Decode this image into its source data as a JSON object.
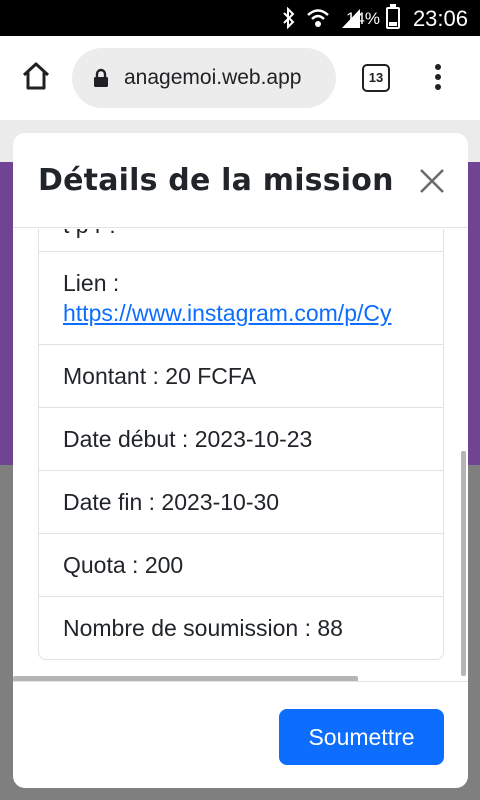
{
  "status_bar": {
    "battery_percent": "14%",
    "time": "23:06",
    "icons": [
      "bluetooth-icon",
      "wifi-icon",
      "signal-icon",
      "battery-icon"
    ]
  },
  "browser": {
    "url": "anagemoi.web.app",
    "tab_count": "13"
  },
  "modal": {
    "title": "Détails de la mission",
    "partial_item": "t p l ?",
    "link_label": "Lien :",
    "link_url": "https://www.instagram.com/p/Cy",
    "items": [
      "Montant : 20 FCFA",
      "Date début : 2023-10-23",
      "Date fin : 2023-10-30",
      "Quota : 200",
      "Nombre de soumission : 88"
    ],
    "submit_label": "Soumettre"
  },
  "colors": {
    "primary": "#0d6efd",
    "page_purple": "#7a4aa0"
  }
}
